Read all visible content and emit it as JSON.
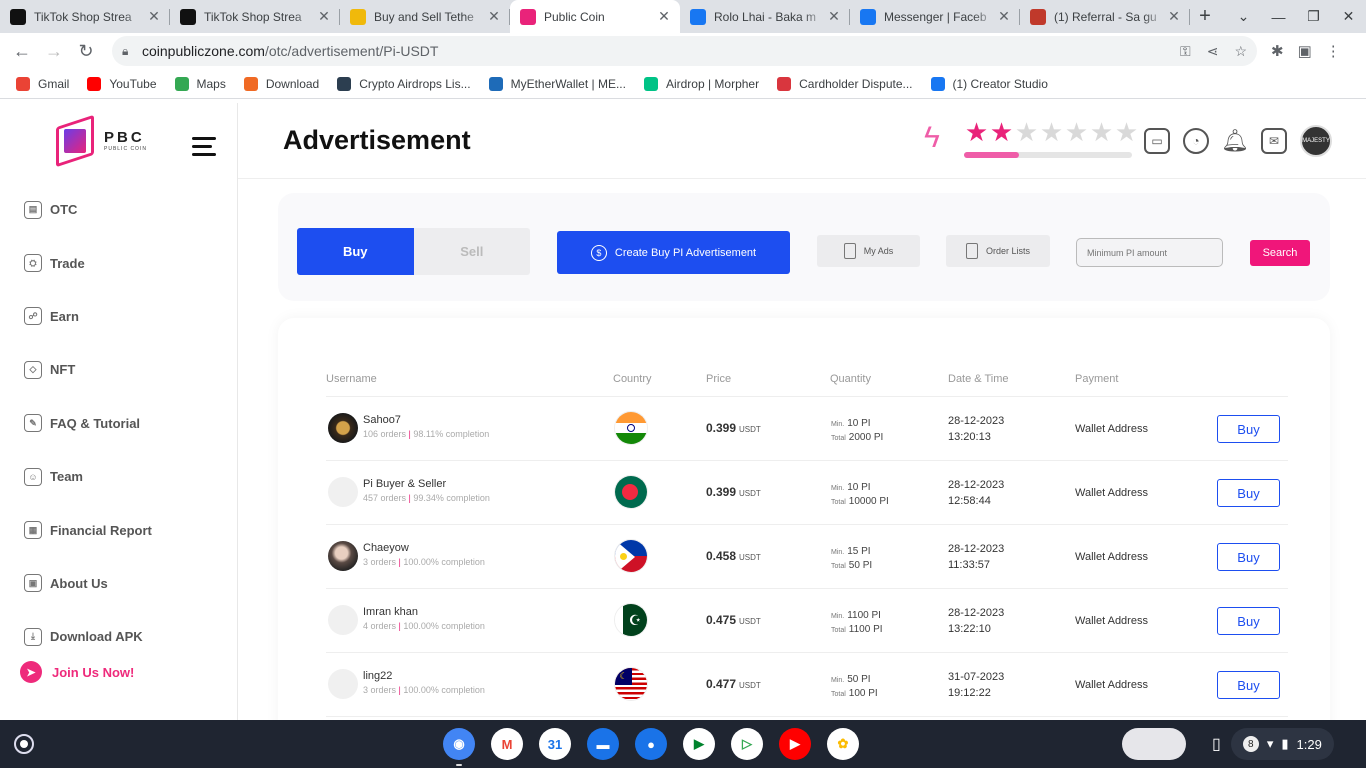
{
  "browser": {
    "tabs": [
      {
        "title": "TikTok Shop Strea",
        "favicon": "tiktok-icon",
        "color": "#111111"
      },
      {
        "title": "TikTok Shop Strea",
        "favicon": "tiktok-icon",
        "color": "#111111"
      },
      {
        "title": "Buy and Sell Tethe",
        "favicon": "binance-icon",
        "color": "#f0b90b"
      },
      {
        "title": "Public Coin",
        "favicon": "pbc-icon",
        "color": "#e9237a",
        "active": true
      },
      {
        "title": "Rolo Lhai - Baka m",
        "favicon": "facebook-icon",
        "color": "#1877f2"
      },
      {
        "title": "Messenger | Faceb",
        "favicon": "facebook-icon",
        "color": "#1877f2"
      },
      {
        "title": "(1) Referral - Sa gu",
        "favicon": "shield-icon",
        "color": "#c0392b"
      }
    ],
    "url_host": "coinpubliczone.com",
    "url_path": "/otc/advertisement/Pi-USDT",
    "bookmarks": [
      {
        "label": "Gmail",
        "color": "#ea4335"
      },
      {
        "label": "YouTube",
        "color": "#ff0000"
      },
      {
        "label": "Maps",
        "color": "#34a853"
      },
      {
        "label": "Download",
        "color": "#f06a24"
      },
      {
        "label": "Crypto Airdrops Lis...",
        "color": "#2c3e50"
      },
      {
        "label": "MyEtherWallet | ME...",
        "color": "#1e6bb8"
      },
      {
        "label": "Airdrop | Morpher",
        "color": "#00c386"
      },
      {
        "label": "Cardholder Dispute...",
        "color": "#d9363e"
      },
      {
        "label": "(1) Creator Studio",
        "color": "#1877f2"
      }
    ]
  },
  "sidebar": {
    "logo_text": "PBC",
    "logo_sub": "PUBLIC COIN",
    "items": [
      {
        "label": "OTC",
        "icon": "chart-icon",
        "name": "otc"
      },
      {
        "label": "Trade",
        "icon": "trade-icon",
        "name": "trade"
      },
      {
        "label": "Earn",
        "icon": "earn-icon",
        "name": "earn"
      },
      {
        "label": "NFT",
        "icon": "nft-icon",
        "name": "nft"
      },
      {
        "label": "FAQ & Tutorial",
        "icon": "faq-icon",
        "name": "faq"
      },
      {
        "label": "Team",
        "icon": "team-icon",
        "name": "team"
      },
      {
        "label": "Financial Report",
        "icon": "report-icon",
        "name": "financial-report"
      },
      {
        "label": "About Us",
        "icon": "about-icon",
        "name": "about-us"
      },
      {
        "label": "Download APK",
        "icon": "download-icon",
        "name": "download-apk"
      }
    ],
    "join_label": "Join Us Now!"
  },
  "header": {
    "title": "Advertisement",
    "rating": 2,
    "rating_max": 7,
    "progress_fraction": 0.33,
    "accent": "#e9237a",
    "avatar_text": "MAJESTY"
  },
  "controls": {
    "buy_label": "Buy",
    "sell_label": "Sell",
    "create_label": "Create Buy PI Advertisement",
    "my_ads_label": "My Ads",
    "order_lists_label": "Order Lists",
    "min_amount_placeholder": "Minimum PI amount",
    "search_label": "Search"
  },
  "table": {
    "headers": {
      "username": "Username",
      "country": "Country",
      "price": "Price",
      "quantity": "Quantity",
      "datetime": "Date & Time",
      "payment": "Payment"
    },
    "rows": [
      {
        "username": "Sahoo7",
        "orders": "106 orders",
        "completion": "98.11% completion",
        "country": "india",
        "price": "0.399",
        "unit": "USDT",
        "min": "10 PI",
        "total": "2000 PI",
        "date": "28-12-2023",
        "time": "13:20:13",
        "payment": "Wallet Address",
        "action": "Buy"
      },
      {
        "username": "Pi Buyer & Seller",
        "orders": "457 orders",
        "completion": "99.34% completion",
        "country": "bangladesh",
        "price": "0.399",
        "unit": "USDT",
        "min": "10 PI",
        "total": "10000 PI",
        "date": "28-12-2023",
        "time": "12:58:44",
        "payment": "Wallet Address",
        "action": "Buy"
      },
      {
        "username": "Chaeyow",
        "orders": "3 orders",
        "completion": "100.00% completion",
        "country": "philippines",
        "price": "0.458",
        "unit": "USDT",
        "min": "15 PI",
        "total": "50 PI",
        "date": "28-12-2023",
        "time": "11:33:57",
        "payment": "Wallet Address",
        "action": "Buy"
      },
      {
        "username": "Imran khan",
        "orders": "4 orders",
        "completion": "100.00% completion",
        "country": "pakistan",
        "price": "0.475",
        "unit": "USDT",
        "min": "1100 PI",
        "total": "1100 PI",
        "date": "28-12-2023",
        "time": "13:22:10",
        "payment": "Wallet Address",
        "action": "Buy"
      },
      {
        "username": "ling22",
        "orders": "3 orders",
        "completion": "100.00% completion",
        "country": "malaysia",
        "price": "0.477",
        "unit": "USDT",
        "min": "50 PI",
        "total": "100 PI",
        "date": "31-07-2023",
        "time": "19:12:22",
        "payment": "Wallet Address",
        "action": "Buy"
      }
    ],
    "min_prefix": "Min.",
    "total_prefix": "Total"
  },
  "shelf": {
    "apps": [
      {
        "name": "chrome-icon",
        "color": "#4285f4"
      },
      {
        "name": "gmail-icon",
        "color": "#ffffff"
      },
      {
        "name": "calendar-icon",
        "color": "#ffffff"
      },
      {
        "name": "files-icon",
        "color": "#1a73e8"
      },
      {
        "name": "messages-icon",
        "color": "#1a73e8"
      },
      {
        "name": "meet-icon",
        "color": "#ffffff"
      },
      {
        "name": "play-store-icon",
        "color": "#ffffff"
      },
      {
        "name": "youtube-icon",
        "color": "#ff0000"
      },
      {
        "name": "photos-icon",
        "color": "#ffffff"
      }
    ],
    "notification_count": "8",
    "clock": "1:29"
  }
}
